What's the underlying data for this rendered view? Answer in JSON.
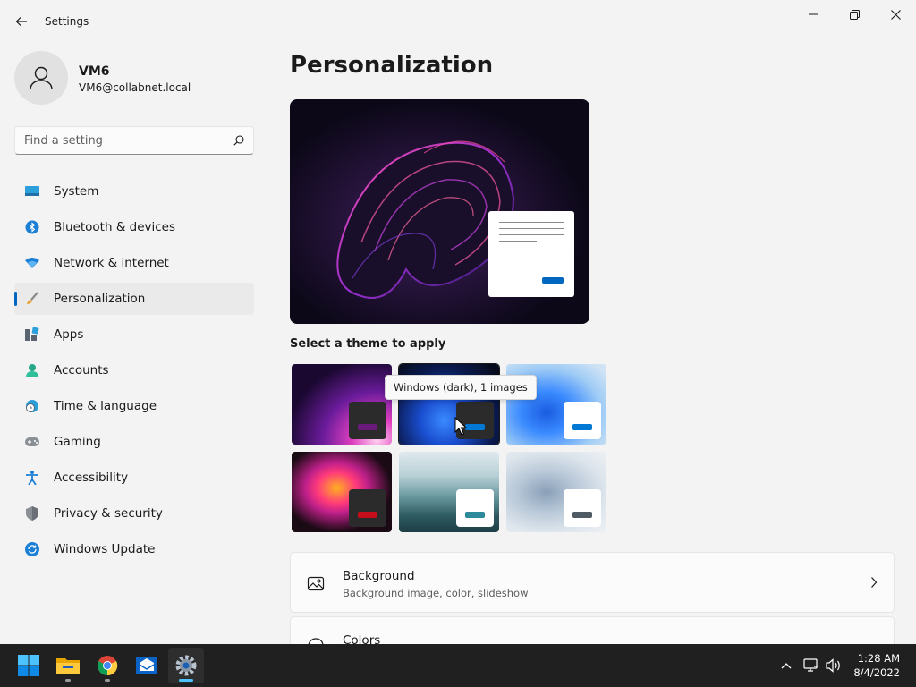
{
  "window": {
    "title": "Settings"
  },
  "user": {
    "name": "VM6",
    "email": "VM6@collabnet.local"
  },
  "search": {
    "placeholder": "Find a setting"
  },
  "sidebar": {
    "items": [
      {
        "label": "System",
        "icon": "system-icon",
        "active": false
      },
      {
        "label": "Bluetooth & devices",
        "icon": "bluetooth-icon",
        "active": false
      },
      {
        "label": "Network & internet",
        "icon": "wifi-icon",
        "active": false
      },
      {
        "label": "Personalization",
        "icon": "paintbrush-icon",
        "active": true
      },
      {
        "label": "Apps",
        "icon": "apps-icon",
        "active": false
      },
      {
        "label": "Accounts",
        "icon": "person-icon",
        "active": false
      },
      {
        "label": "Time & language",
        "icon": "clock-globe-icon",
        "active": false
      },
      {
        "label": "Gaming",
        "icon": "gamepad-icon",
        "active": false
      },
      {
        "label": "Accessibility",
        "icon": "accessibility-icon",
        "active": false
      },
      {
        "label": "Privacy & security",
        "icon": "shield-icon",
        "active": false
      },
      {
        "label": "Windows Update",
        "icon": "update-icon",
        "active": false
      }
    ]
  },
  "main": {
    "title": "Personalization",
    "theme_heading": "Select a theme to apply",
    "tooltip": "Windows (dark), 1 images",
    "themes": [
      {
        "name": "glow",
        "swatch_color": "#6a1b7a"
      },
      {
        "name": "windows-dark",
        "swatch_color": "#0078d4"
      },
      {
        "name": "windows-light",
        "swatch_color": "#0078d4"
      },
      {
        "name": "captured-motion",
        "swatch_color": "#c40e1c"
      },
      {
        "name": "sunrise-lake",
        "swatch_color": "#2d8a9a"
      },
      {
        "name": "flow",
        "swatch_color": "#505a63"
      }
    ],
    "cards": [
      {
        "title": "Background",
        "subtitle": "Background image, color, slideshow",
        "icon": "picture-icon"
      },
      {
        "title": "Colors",
        "subtitle": "",
        "icon": "palette-icon"
      }
    ]
  },
  "taskbar": {
    "apps": [
      "start-icon",
      "file-explorer-icon",
      "chrome-icon",
      "mail-icon",
      "settings-icon"
    ],
    "active_app": "settings-icon",
    "time": "1:28 AM",
    "date": "8/4/2022"
  },
  "colors": {
    "accent": "#0067c0",
    "taskbar": "#202020"
  }
}
